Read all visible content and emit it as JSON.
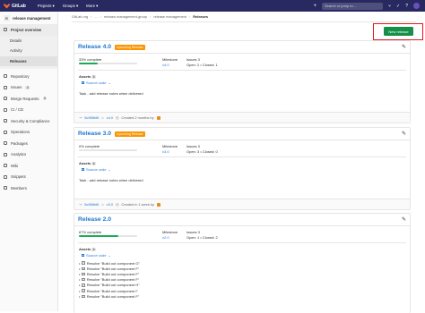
{
  "topbar": {
    "brand": "GitLab",
    "nav": [
      "Projects ▾",
      "Groups ▾",
      "More ▾"
    ],
    "search_placeholder": "Search or jump to..."
  },
  "sidebar": {
    "project_initial": "R",
    "project_name": "release management",
    "overview": "Project overview",
    "sub_items": [
      "Details",
      "Activity",
      "Releases"
    ],
    "items": [
      "Repository",
      "Issues",
      "Merge Requests",
      "CI / CD",
      "Security & Compliance",
      "Operations",
      "Packages",
      "Analytics",
      "Wiki",
      "Snippets",
      "Members"
    ],
    "issues_count": "3",
    "mr_count": "0"
  },
  "breadcrumb": {
    "items": [
      "GitLab.org",
      "...",
      "release-management-group",
      "release management",
      "Releases"
    ]
  },
  "new_release": "New release",
  "releases": [
    {
      "title": "Release 4.0",
      "badge": "Upcoming Release",
      "pct_label": "33% complete",
      "pct": 0.33,
      "milestone_label": "Milestone",
      "milestone": "v4.0",
      "issues_label": "Issues 3",
      "issues": "Open: 2 • Closed: 1",
      "assets_label": "Assets",
      "assets_count": "4",
      "source_code": "Source code",
      "description": [
        "Task - add release notes when delivered"
      ],
      "sha": "5c986fd5",
      "tag": "v4.0",
      "created": "Created 2 months by"
    },
    {
      "title": "Release 3.0",
      "badge": "Upcoming Release",
      "pct_label": "0% complete",
      "pct": 0,
      "milestone_label": "Milestone",
      "milestone": "v3.0",
      "issues_label": "Issues 3",
      "issues": "Open: 3 • Closed: 0",
      "assets_label": "Assets",
      "assets_count": "4",
      "source_code": "Source code",
      "description": [
        "Task - add release notes when delivered"
      ],
      "sha": "5c986fd5",
      "tag": "v3.0",
      "created": "Created in 1 week by"
    },
    {
      "title": "Release 2.0",
      "badge": "",
      "pct_label": "67% complete",
      "pct": 0.67,
      "milestone_label": "Milestone",
      "milestone": "v2.0",
      "issues_label": "Issues 3",
      "issues": "Open: 1 • Closed: 2",
      "assets_label": "Assets",
      "assets_count": "4",
      "source_code": "Source code",
      "description": [
        "Resolve \"Build out component G\"",
        "Resolve \"Build out component F\"",
        "Resolve \"Build out component F\"",
        "Resolve \"Build out component F\"",
        "Resolve \"Build out component H\"",
        "Resolve \"Build out component I\"",
        "Resolve \"Build out component F\""
      ]
    }
  ]
}
